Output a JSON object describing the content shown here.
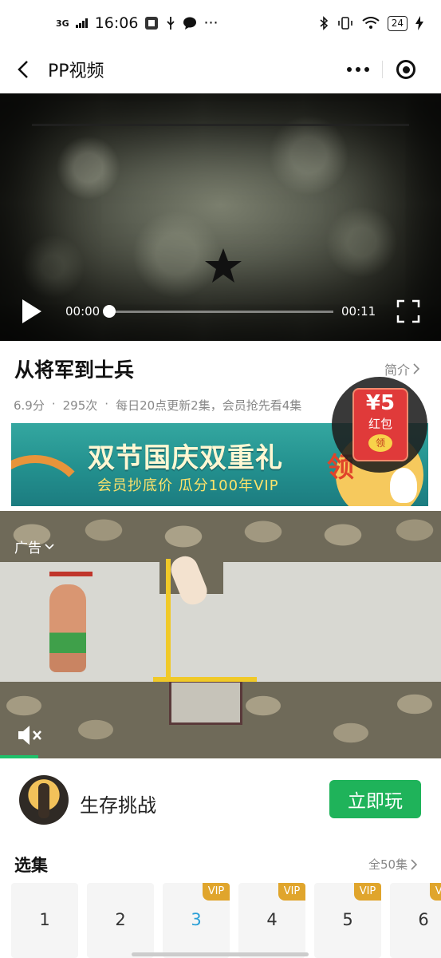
{
  "status_bar": {
    "network": "3G",
    "time": "16:06",
    "battery": "24"
  },
  "nav": {
    "title": "PP视频"
  },
  "player": {
    "current_time": "00:00",
    "duration": "00:11",
    "progress": 0
  },
  "show": {
    "title": "从将军到士兵",
    "intro_label": "简介",
    "score": "6.9分",
    "plays": "295次",
    "update_info": "每日20点更新2集，会员抢先看4集"
  },
  "banner": {
    "title": "双节国庆双重礼",
    "subtitle": "会员抄底价 瓜分100年VIP",
    "claim": "领"
  },
  "red_packet": {
    "amount": "¥5",
    "label": "红包",
    "claim": "领"
  },
  "ad": {
    "label": "广告"
  },
  "game": {
    "name": "生存挑战",
    "play_label": "立即玩"
  },
  "episodes": {
    "title": "选集",
    "all_label": "全50集",
    "items": [
      {
        "num": "1",
        "vip": ""
      },
      {
        "num": "2",
        "vip": ""
      },
      {
        "num": "3",
        "vip": "VIP"
      },
      {
        "num": "4",
        "vip": "VIP"
      },
      {
        "num": "5",
        "vip": "VIP"
      },
      {
        "num": "6",
        "vip": "VIP"
      }
    ],
    "active": "3"
  },
  "colors": {
    "accent_green": "#1fb35a",
    "vip_gold": "#e0a52c",
    "active_episode": "#2a9fd6"
  }
}
